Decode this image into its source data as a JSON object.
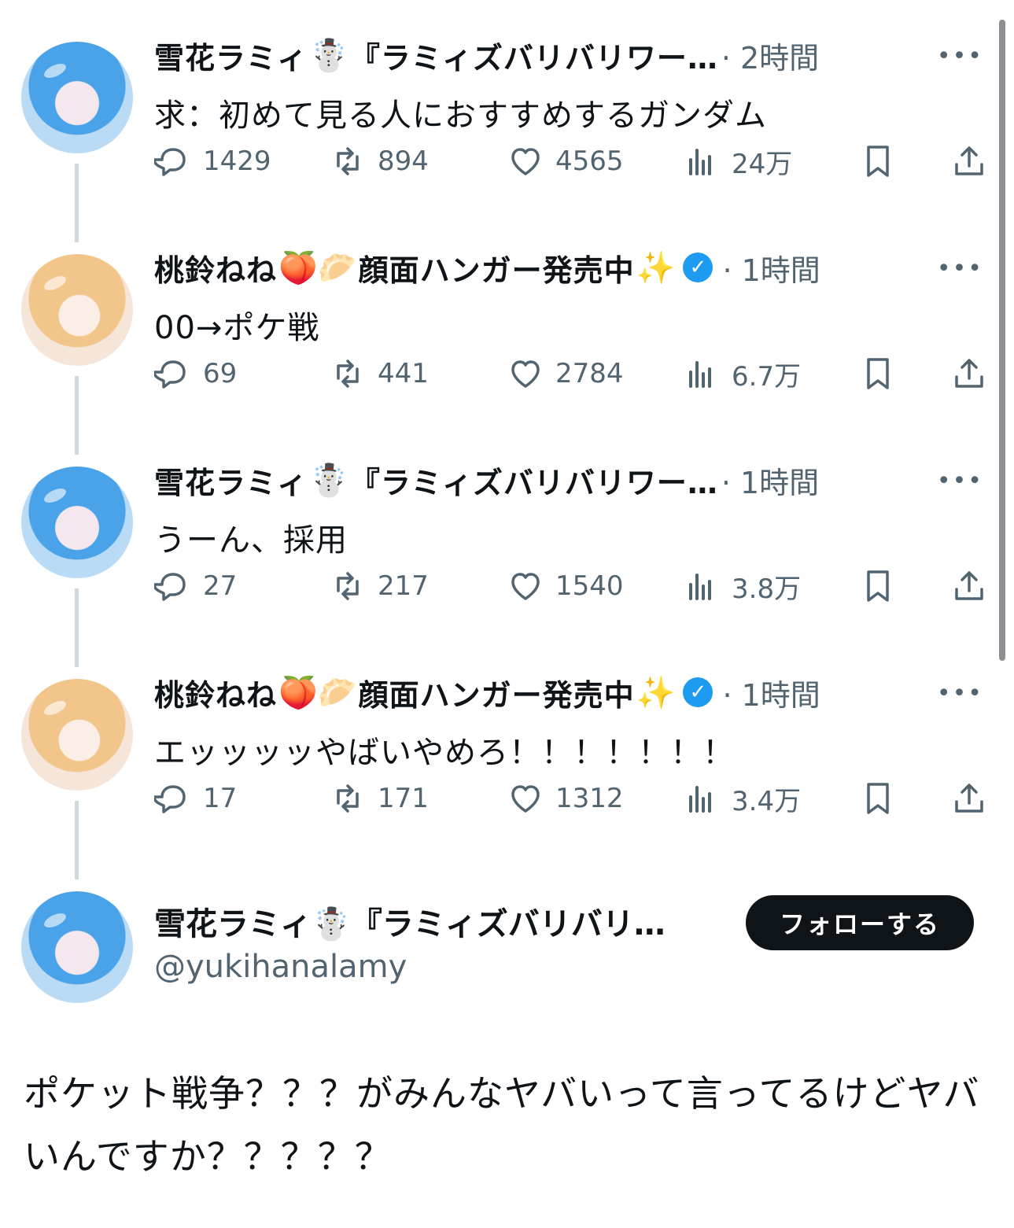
{
  "tweets": [
    {
      "name": "雪花ラミィ",
      "name_suffix": "『ラミィズバリバリワー…",
      "name_emoji": "☃️",
      "time": "· 2時間",
      "text": "求：初めて見る人におすすめするガンダム",
      "replies": "1429",
      "retweets": "894",
      "likes": "4565",
      "views": "24万",
      "avatar": "blue"
    },
    {
      "name": "桃鈴ねね",
      "name_suffix": "顔面ハンガー発売中",
      "name_emoji": "🍑🥟",
      "name_emoji_end": "✨",
      "time": "· 1時間",
      "text": "00→ポケ戦",
      "replies": "69",
      "retweets": "441",
      "likes": "2784",
      "views": "6.7万",
      "avatar": "pink",
      "verified": "✓"
    },
    {
      "name": "雪花ラミィ",
      "name_suffix": "『ラミィズバリバリワー…",
      "name_emoji": "☃️",
      "time": "· 1時間",
      "text": "うーん、採用",
      "replies": "27",
      "retweets": "217",
      "likes": "1540",
      "views": "3.8万",
      "avatar": "blue"
    },
    {
      "name": "桃鈴ねね",
      "name_suffix": "顔面ハンガー発売中",
      "name_emoji": "🍑🥟",
      "name_emoji_end": "✨",
      "time": "· 1時間",
      "text": "エッッッッやばいやめろ！！！！！！！",
      "replies": "17",
      "retweets": "171",
      "likes": "1312",
      "views": "3.4万",
      "avatar": "pink",
      "verified": "✓"
    }
  ],
  "more_label": "•••",
  "main": {
    "name": "雪花ラミィ☃️『ラミィズバリバリ…",
    "handle": "@yukihanalamy",
    "follow_label": "フォローする",
    "text": "ポケット戦争？？？がみんなヤバいって言ってるけどヤバいんですか？？？？？"
  }
}
